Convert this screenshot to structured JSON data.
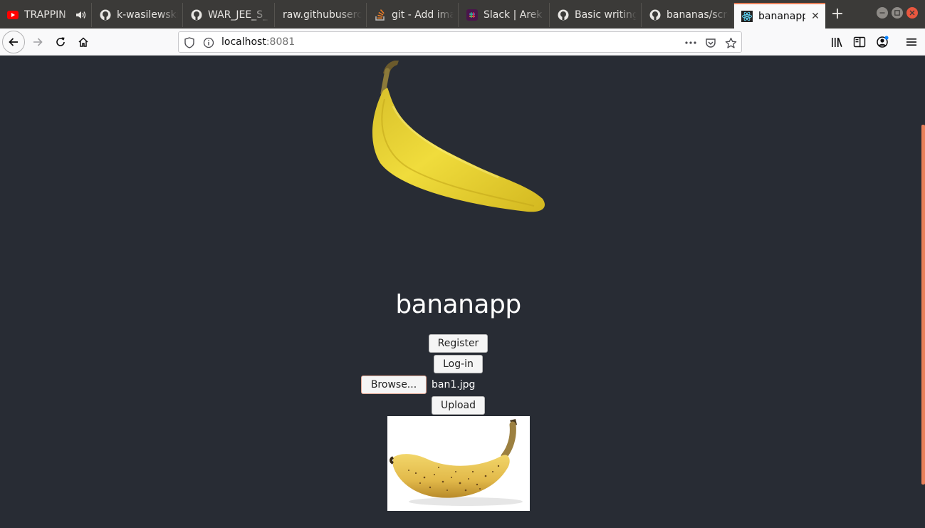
{
  "browser": {
    "tabs": [
      {
        "title": "TRAPPIN",
        "icon": "youtube-icon",
        "sound": true
      },
      {
        "title": "k-wasilewski/",
        "icon": "github-icon"
      },
      {
        "title": "WAR_JEE_S_",
        "icon": "github-icon"
      },
      {
        "title": "raw.githubuserco",
        "icon": "none"
      },
      {
        "title": "git - Add ima",
        "icon": "stackoverflow-icon"
      },
      {
        "title": "Slack | Arek J",
        "icon": "slack-icon"
      },
      {
        "title": "Basic writing",
        "icon": "github-icon"
      },
      {
        "title": "bananas/scre",
        "icon": "github-icon"
      },
      {
        "title": "bananapp",
        "icon": "react-icon",
        "active": true
      }
    ],
    "url": {
      "host": "localhost",
      "port": ":8081"
    },
    "colors": {
      "accent": "#e9805a",
      "tabstrip": "#3b3a38",
      "toolbar": "#f9f9fa"
    }
  },
  "page": {
    "background": "#282c34",
    "title": "bananapp",
    "register_label": "Register",
    "login_label": "Log-in",
    "browse_label": "Browse...",
    "file_name": "ban1.jpg",
    "upload_label": "Upload"
  }
}
